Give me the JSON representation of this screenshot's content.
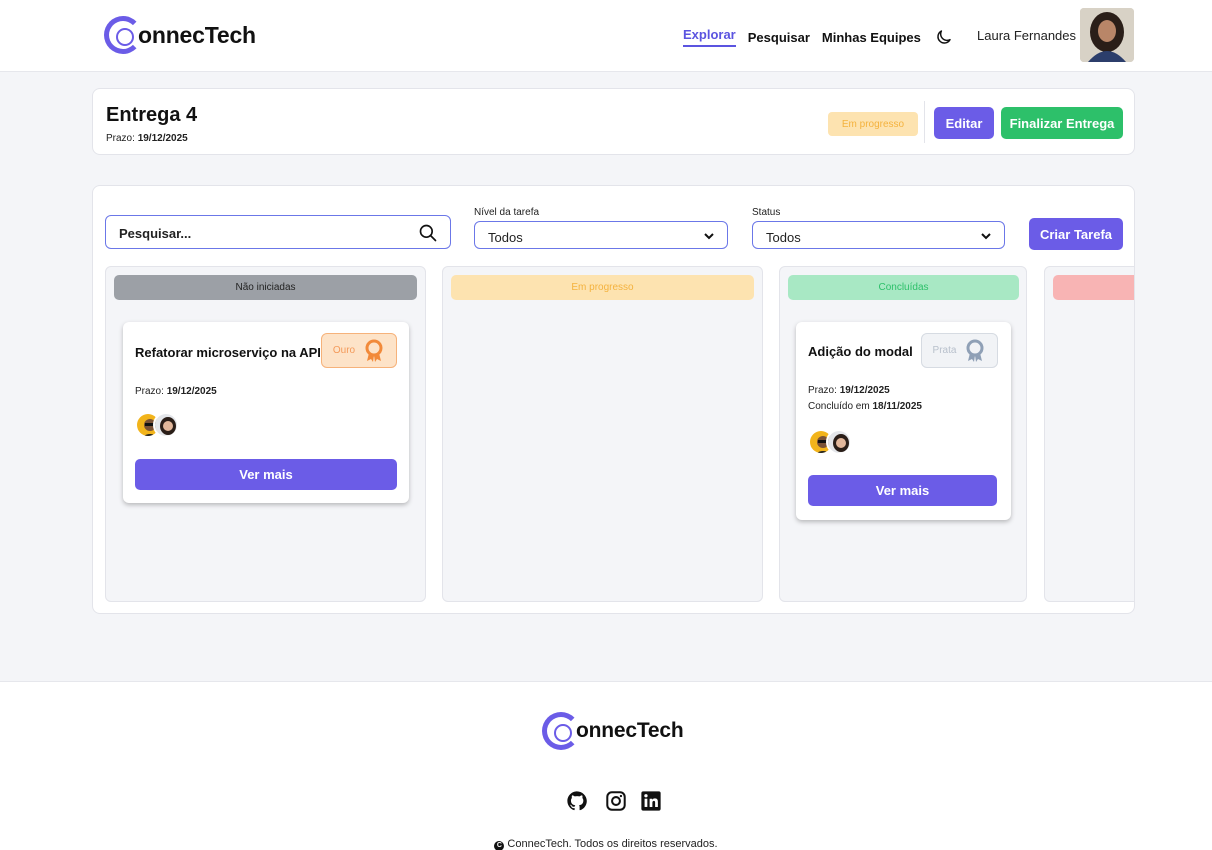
{
  "brand": {
    "name_rest": "onnecTech"
  },
  "nav": {
    "explorar": "Explorar",
    "pesquisar": "Pesquisar",
    "equipes": "Minhas Equipes"
  },
  "user": {
    "name": "Laura Fernandes"
  },
  "entrega": {
    "title": "Entrega 4",
    "prazo_label": "Prazo:",
    "prazo_value": "19/12/2025",
    "status": "Em progresso",
    "edit_label": "Editar",
    "finish_label": "Finalizar Entrega"
  },
  "filters": {
    "search_placeholder": "Pesquisar...",
    "nivel_label": "Nível da tarefa",
    "nivel_value": "Todos",
    "status_label": "Status",
    "status_value": "Todos",
    "create_label": "Criar Tarefa"
  },
  "columns": [
    {
      "title": "Não iniciadas",
      "color": "#9ca0a6",
      "text_color": "#222222"
    },
    {
      "title": "Em progresso",
      "color": "#fde3b0",
      "text_color": "#f4b23e"
    },
    {
      "title": "Concluídas",
      "color": "#a8e8c4",
      "text_color": "#2dc06a"
    },
    {
      "title": "",
      "color": "#f8b4b4",
      "text_color": "#e05555"
    }
  ],
  "tasks": [
    {
      "title": "Refatorar microserviço na API",
      "medal": "Ouro",
      "prazo_label": "Prazo:",
      "prazo_value": "19/12/2025",
      "button": "Ver mais"
    },
    {
      "title": "Adição do modal",
      "medal": "Prata",
      "prazo_label": "Prazo:",
      "prazo_value": "19/12/2025",
      "concluido_label": "Concluído em",
      "concluido_value": "18/11/2025",
      "button": "Ver mais"
    }
  ],
  "footer": {
    "copyright": "ConnecTech. Todos os direitos reservados."
  },
  "colors": {
    "accent": "#6b5ce7",
    "success": "#2dc06a",
    "warning": "#f4b23e"
  }
}
